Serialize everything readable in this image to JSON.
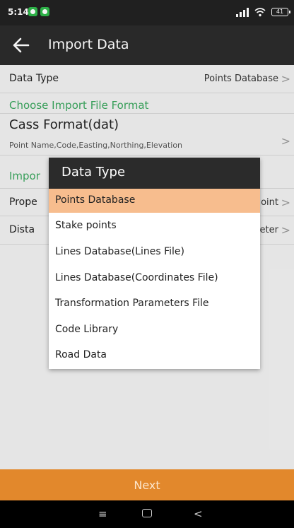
{
  "status": {
    "time": "5:14",
    "battery": "41"
  },
  "appbar": {
    "title": "Import Data"
  },
  "data_type_row": {
    "label": "Data Type",
    "value": "Points Database"
  },
  "format_section": {
    "header": "Choose Import File Format"
  },
  "cass": {
    "title": "Cass Format(dat)",
    "subtitle": "Point Name,Code,Easting,Northing,Elevation"
  },
  "import_section": {
    "header_visible": "Impor"
  },
  "property_row": {
    "label_visible": "Prope",
    "value_visible": "oint"
  },
  "distance_row": {
    "label_visible": "Dista",
    "value_visible": "eter"
  },
  "dialog": {
    "title": "Data Type",
    "items": [
      "Points Database",
      "Stake points",
      "Lines Database(Lines File)",
      "Lines Database(Coordinates File)",
      "Transformation Parameters File",
      "Code Library",
      "Road Data"
    ],
    "selected_index": 0
  },
  "next_button": {
    "label": "Next"
  },
  "colors": {
    "accent_orange": "#e2882c",
    "selected_item": "#f7bd8e",
    "section_green": "#3aa55d",
    "appbar": "#2b2b2b"
  },
  "icons": [
    "back-arrow-icon",
    "signal-icon",
    "wifi-icon",
    "battery-icon",
    "chevron-right-icon",
    "menu-icon",
    "home-icon",
    "back-icon"
  ]
}
